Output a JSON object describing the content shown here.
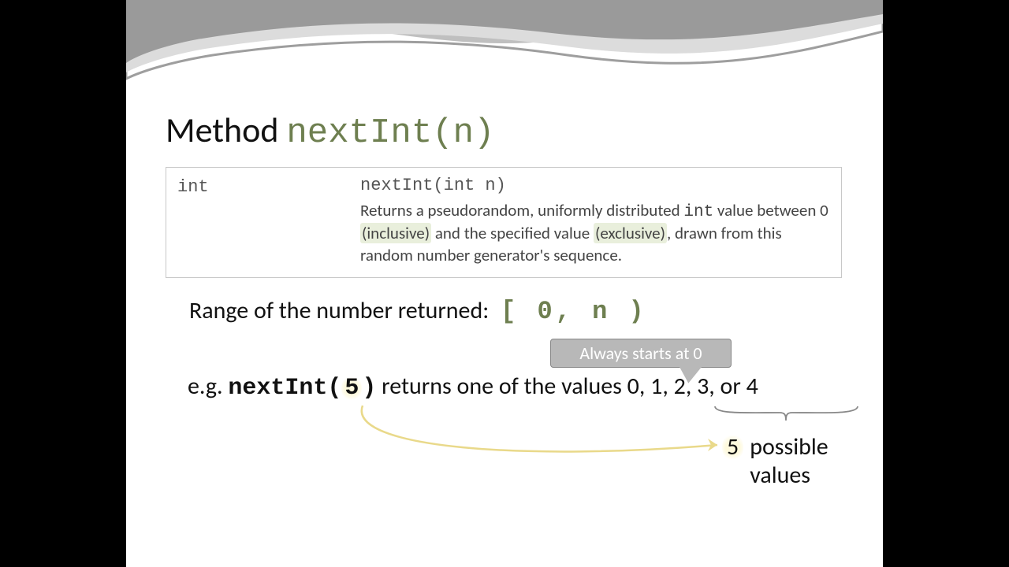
{
  "title": {
    "prefix": "Method ",
    "mono": "nextInt(n)"
  },
  "doc": {
    "ret_type": "int",
    "signature": "nextInt(int n)",
    "desc1a": "Returns a pseudorandom, uniformly distributed ",
    "desc1b": "int",
    "desc1c": " value between 0 ",
    "inclusive": "(inclusive)",
    "desc2": " and the specified value ",
    "exclusive": "(exclusive)",
    "desc3": ", drawn from this random number generator's sequence."
  },
  "range": {
    "label": "Range of the number returned:",
    "interval": "[ 0, n )"
  },
  "callout": "Always starts at 0",
  "example": {
    "prefix": "e.g.  ",
    "call_a": "nextInt(",
    "five": "5",
    "call_b": ")",
    "suffix": "  returns one of the values 0, 1, 2, 3, or 4"
  },
  "possible": {
    "count": "5",
    "label1": "possible",
    "label2": "values"
  }
}
